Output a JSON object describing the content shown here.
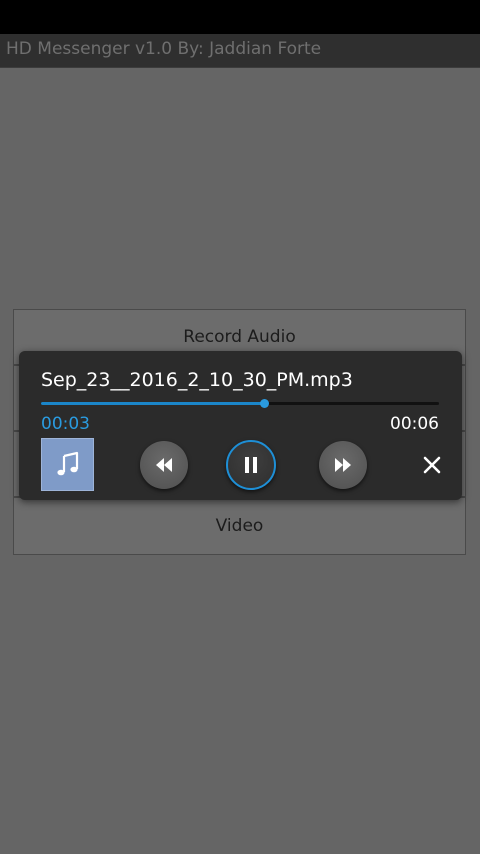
{
  "app": {
    "title": "HD Messenger v1.0 By: Jaddian Forte"
  },
  "menu": {
    "record_audio": "Record Audio",
    "video": "Video"
  },
  "player": {
    "file_name": "Sep_23__2016_2_10_30_PM.mp3",
    "elapsed": "00:03",
    "total": "00:06",
    "progress": 0.56,
    "icons": {
      "album": "music-note-icon",
      "rewind": "rewind-icon",
      "pause": "pause-icon",
      "forward": "fast-forward-icon",
      "close": "close-icon"
    }
  },
  "colors": {
    "accent": "#1e8fd6",
    "player_bg": "#2b2b2b",
    "backdrop": "#656565"
  }
}
